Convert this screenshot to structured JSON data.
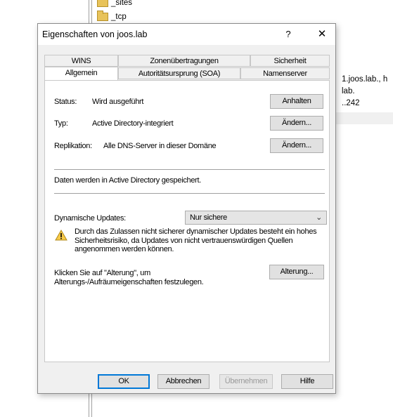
{
  "background": {
    "tree_items": [
      "_sites",
      "_tcp"
    ],
    "right_lines": [
      "1.joos.lab., h",
      "lab.",
      "..242"
    ]
  },
  "dialog": {
    "title": "Eigenschaften von joos.lab",
    "help_glyph": "?",
    "close_glyph": "✕",
    "tabs_row1": [
      "WINS",
      "Zonenübertragungen",
      "Sicherheit"
    ],
    "tabs_row2": [
      "Allgemein",
      "Autoritätsursprung (SOA)",
      "Namenserver"
    ],
    "active_tab": "Allgemein",
    "status_label": "Status:",
    "status_value": "Wird ausgeführt",
    "pause_button": "Anhalten",
    "type_label": "Typ:",
    "type_value": "Active Directory-integriert",
    "change_type_button": "Ändern...",
    "replication_label": "Replikation:",
    "replication_value": "Alle DNS-Server in dieser Domäne",
    "change_replication_button": "Ändern...",
    "storage_text": "Daten werden in Active Directory gespeichert.",
    "dynamic_updates_label": "Dynamische Updates:",
    "dynamic_updates_value": "Nur sichere",
    "warning_text": "Durch das Zulassen nicht sicherer dynamischer Updates besteht ein hohes Sicherheitsrisiko, da Updates von nicht vertrauenswürdigen Quellen angenommen werden können.",
    "aging_text": "Klicken Sie auf \"Alterung\", um Alterungs-/Aufräumeigenschaften festzulegen.",
    "aging_button": "Alterung...",
    "ok_button": "OK",
    "cancel_button": "Abbrechen",
    "apply_button": "Übernehmen",
    "help_button": "Hilfe"
  }
}
